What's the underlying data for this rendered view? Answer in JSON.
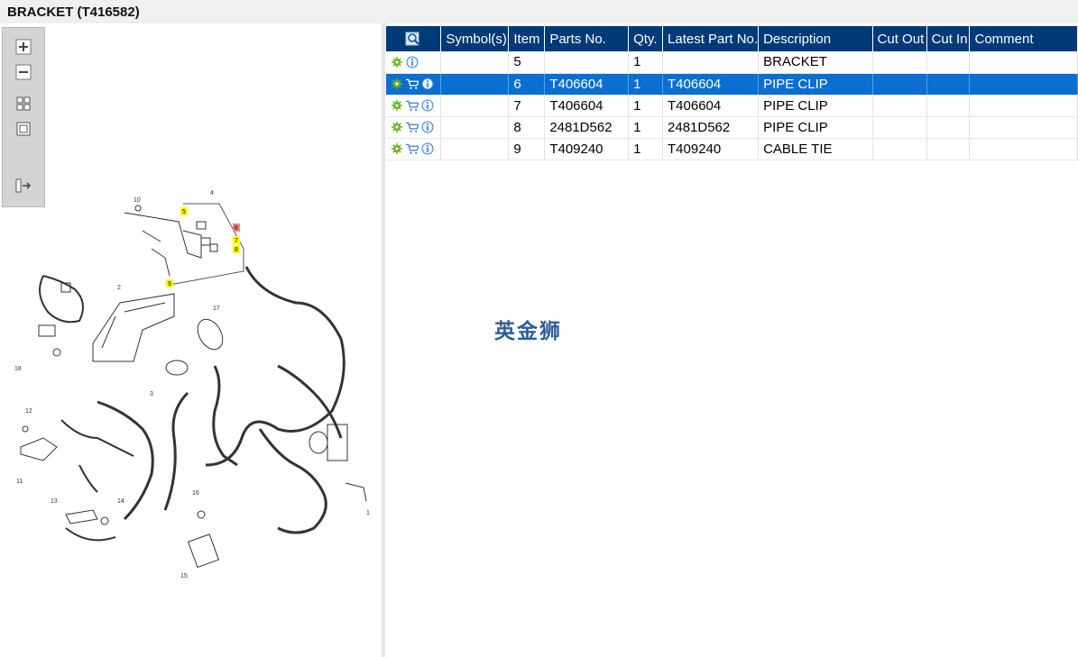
{
  "window": {
    "title": "BRACKET (T416582)"
  },
  "toolbox": {
    "icons": [
      "zoom-in-icon",
      "zoom-out-icon",
      "fit-grid-icon",
      "actual-size-icon",
      "expand-panel-icon"
    ]
  },
  "diagram": {
    "callouts": [
      "1",
      "2",
      "3",
      "4",
      "5",
      "6",
      "7",
      "8",
      "9",
      "10",
      "11",
      "12",
      "13",
      "14",
      "15",
      "16",
      "17",
      "18"
    ],
    "highlight_yellow": "#ffff00",
    "highlight_red": "#f08080"
  },
  "table": {
    "headers": {
      "search": "",
      "symbols": "Symbol(s)",
      "item": "Item",
      "parts_no": "Parts No.",
      "qty": "Qty.",
      "latest": "Latest Part No.",
      "description": "Description",
      "cut_out": "Cut Out",
      "cut_in": "Cut In",
      "comment": "Comment"
    },
    "rows": [
      {
        "item": "5",
        "parts_no": "",
        "qty": "1",
        "latest": "",
        "description": "BRACKET",
        "cut_out": "",
        "cut_in": "",
        "comment": "",
        "has_cart": false,
        "selected": false
      },
      {
        "item": "6",
        "parts_no": "T406604",
        "qty": "1",
        "latest": "T406604",
        "description": "PIPE CLIP",
        "cut_out": "",
        "cut_in": "",
        "comment": "",
        "has_cart": true,
        "selected": true
      },
      {
        "item": "7",
        "parts_no": "T406604",
        "qty": "1",
        "latest": "T406604",
        "description": "PIPE CLIP",
        "cut_out": "",
        "cut_in": "",
        "comment": "",
        "has_cart": true,
        "selected": false
      },
      {
        "item": "8",
        "parts_no": "2481D562",
        "qty": "1",
        "latest": "2481D562",
        "description": "PIPE CLIP",
        "cut_out": "",
        "cut_in": "",
        "comment": "",
        "has_cart": true,
        "selected": false
      },
      {
        "item": "9",
        "parts_no": "T409240",
        "qty": "1",
        "latest": "T409240",
        "description": "CABLE TIE",
        "cut_out": "",
        "cut_in": "",
        "comment": "",
        "has_cart": true,
        "selected": false
      }
    ]
  },
  "watermark": "英金狮",
  "colors": {
    "header_bg": "#003a78",
    "selected_row": "#0a6fd0",
    "gear": "#6ab023",
    "info": "#3a7fd0"
  }
}
